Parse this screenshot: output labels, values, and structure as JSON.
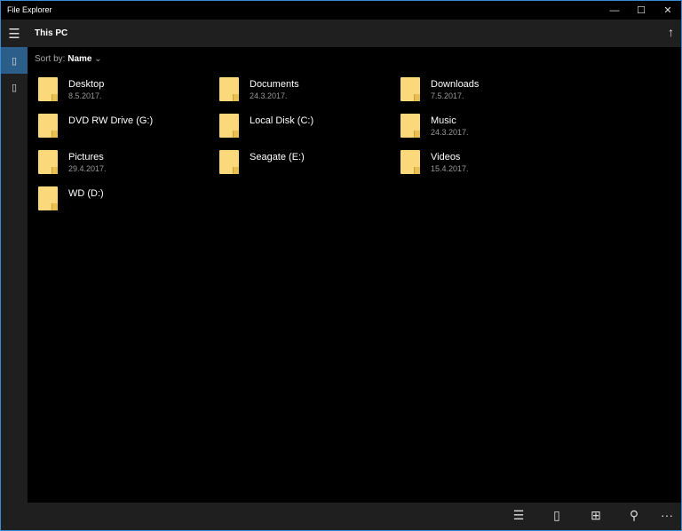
{
  "window": {
    "title": "File Explorer",
    "minimize": "—",
    "maximize": "☐",
    "close": "✕"
  },
  "header": {
    "title": "This PC",
    "menu_icon": "☰",
    "up_icon": "↑"
  },
  "sidebar": {
    "items": [
      {
        "icon": "▯",
        "selected": true
      },
      {
        "icon": "▯",
        "selected": false
      }
    ]
  },
  "sort": {
    "label": "Sort by:",
    "value": "Name",
    "chevron": "⌄"
  },
  "items": [
    {
      "name": "Desktop",
      "date": "8.5.2017."
    },
    {
      "name": "Documents",
      "date": "24.3.2017."
    },
    {
      "name": "Downloads",
      "date": "7.5.2017."
    },
    {
      "name": "DVD RW Drive (G:)",
      "date": ""
    },
    {
      "name": "Local Disk (C:)",
      "date": ""
    },
    {
      "name": "Music",
      "date": "24.3.2017."
    },
    {
      "name": "Pictures",
      "date": "29.4.2017."
    },
    {
      "name": "Seagate (E:)",
      "date": ""
    },
    {
      "name": "Videos",
      "date": "15.4.2017."
    },
    {
      "name": "WD (D:)",
      "date": ""
    }
  ],
  "toolbar": {
    "select": "☰",
    "new": "▯",
    "view": "⊞",
    "search": "⚲",
    "more": "···"
  }
}
